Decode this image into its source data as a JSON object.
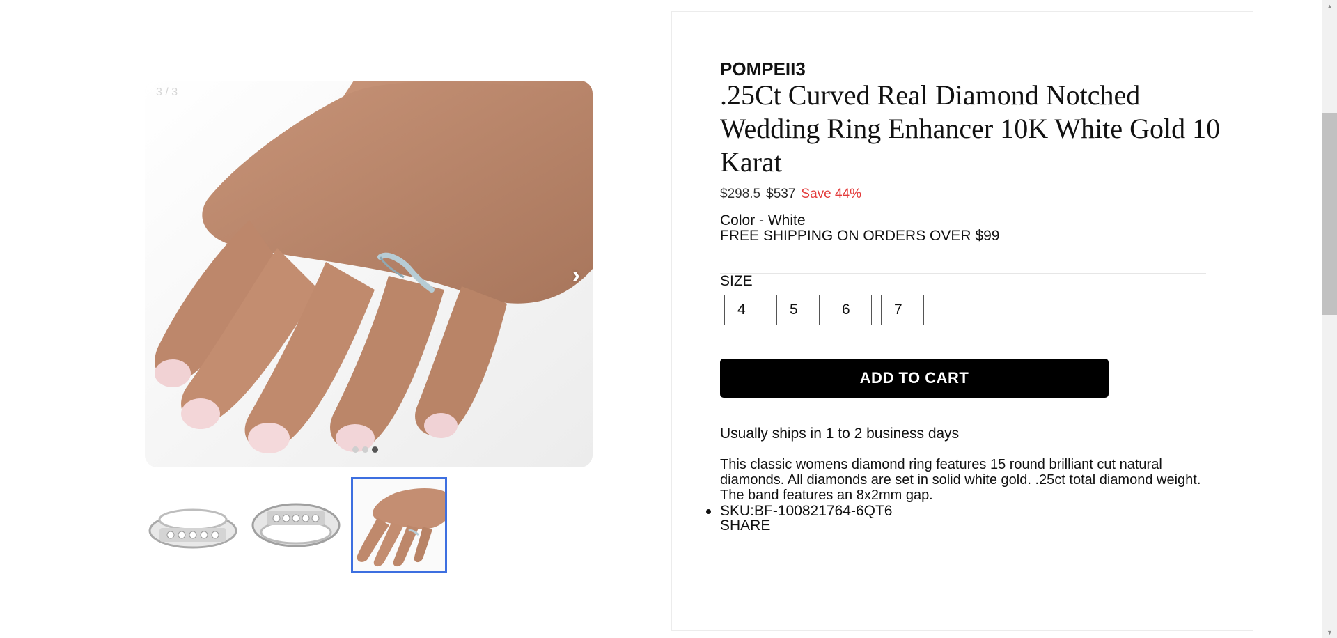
{
  "gallery": {
    "counter": "3 / 3",
    "next_arrow": "›",
    "slide_count": 3,
    "active_slide": 3,
    "thumbnails": [
      "ring-front-view",
      "ring-angle-view",
      "ring-on-hand-view"
    ]
  },
  "product": {
    "brand": "POMPEII3",
    "title": ".25Ct Curved Real Diamond Notched Wedding Ring Enhancer 10K White Gold 10 Karat",
    "price_old": "$298.5",
    "price_new": "$537",
    "save": "Save 44%",
    "color": "Color - White",
    "shipping_banner": "FREE SHIPPING ON ORDERS OVER $99",
    "size_label": "SIZE",
    "sizes": [
      "4",
      "5",
      "6",
      "7"
    ],
    "add_to_cart": "ADD TO CART",
    "ships_in": "Usually ships in 1 to 2 business days",
    "description": "This classic womens diamond ring features 15 round brilliant cut natural diamonds. All diamonds are set in solid white gold. .25ct total diamond weight. The band features an 8x2mm gap.",
    "sku": "SKU:BF-100821764-6QT6",
    "share": "SHARE"
  },
  "colors": {
    "accent": "#3d6fe0",
    "save_red": "#e33b3b",
    "button_bg": "#000000"
  }
}
